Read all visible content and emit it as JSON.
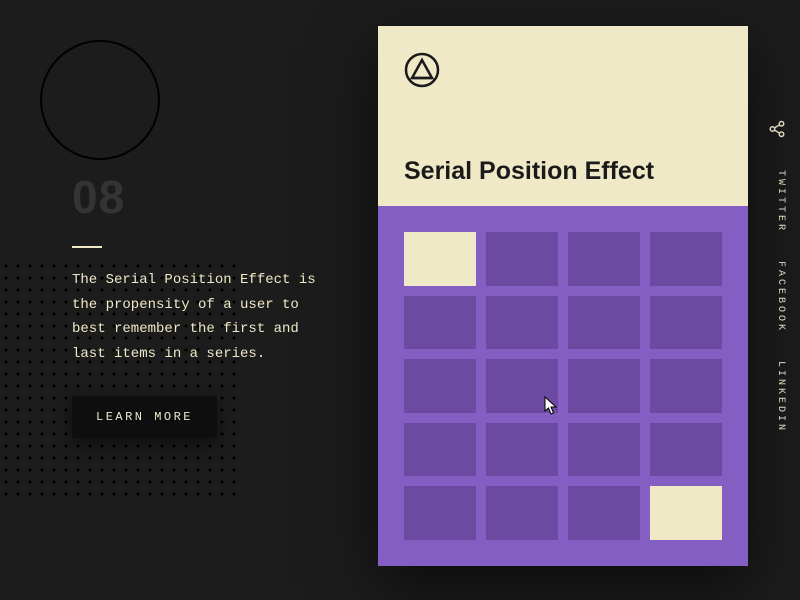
{
  "index": "08",
  "description": "The Serial Position Effect is the propensity of a user to best remember the first and last items in a series.",
  "learn_more_label": "LEARN MORE",
  "card": {
    "title": "Serial Position Effect",
    "grid": {
      "rows": 5,
      "cols": 4,
      "highlighted": [
        0,
        19
      ]
    }
  },
  "share": {
    "links": [
      "TWITTER",
      "FACEBOOK",
      "LINKEDIN"
    ]
  },
  "colors": {
    "cream": "#efe9c7",
    "purple": "#845ec2",
    "purple_dark": "#6c4aa1",
    "bg": "#1c1c1c"
  }
}
